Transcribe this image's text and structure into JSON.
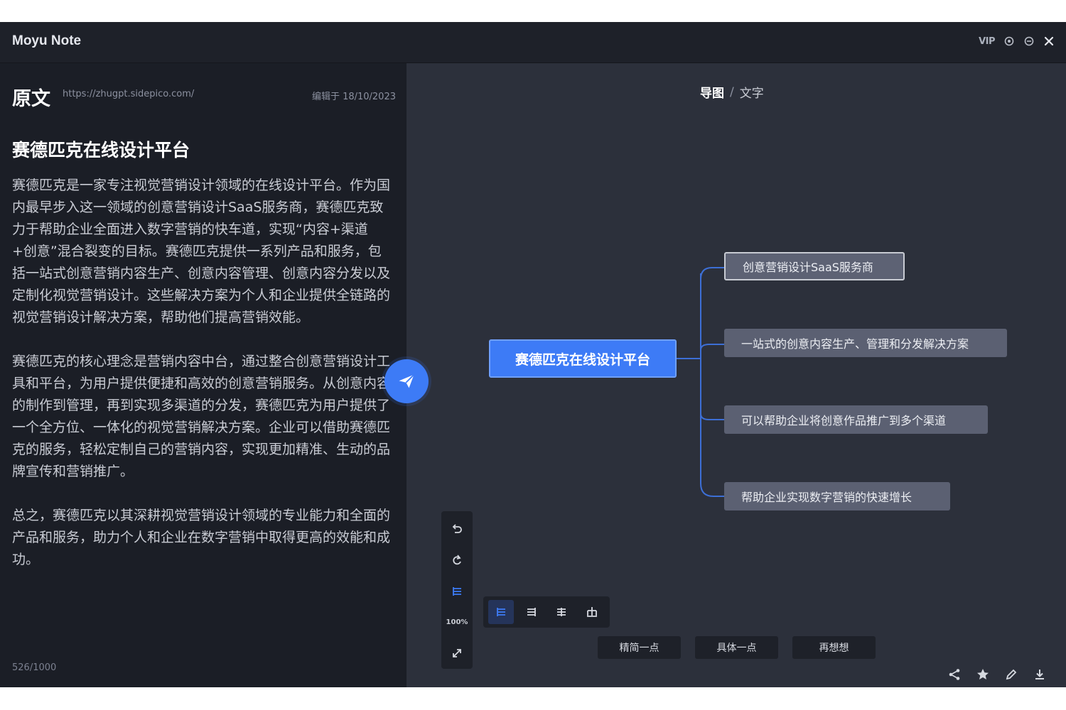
{
  "app": {
    "title": "Moyu Note",
    "vip_label": "VIP"
  },
  "left": {
    "heading": "原文",
    "url": "https://zhugpt.sidepico.com/",
    "edited": "编辑于 18/10/2023",
    "doc_title": "赛德匹克在线设计平台",
    "paragraphs": [
      "赛德匹克是一家专注视觉营销设计领域的在线设计平台。作为国内最早步入这一领域的创意营销设计SaaS服务商，赛德匹克致力于帮助企业全面进入数字营销的快车道，实现“内容+渠道+创意”混合裂变的目标。赛德匹克提供一系列产品和服务，包括一站式创意营销内容生产、创意内容管理、创意内容分发以及定制化视觉营销设计。这些解决方案为个人和企业提供全链路的视觉营销设计解决方案，帮助他们提高营销效能。",
      "赛德匹克的核心理念是营销内容中台，通过整合创意营销设计工具和平台，为用户提供便捷和高效的创意营销服务。从创意内容的制作到管理，再到实现多渠道的分发，赛德匹克为用户提供了一个全方位、一体化的视觉营销解决方案。企业可以借助赛德匹克的服务，轻松定制自己的营销内容，实现更加精准、生动的品牌宣传和营销推广。",
      "总之，赛德匹克以其深耕视觉营销设计领域的专业能力和全面的产品和服务，助力个人和企业在数字营销中取得更高的效能和成功。"
    ],
    "char_count": "526/1000"
  },
  "canvas": {
    "breadcrumb": {
      "active": "导图",
      "separator": "/",
      "other": "文字"
    },
    "mindmap": {
      "root": "赛德匹克在线设计平台",
      "children": [
        "创意营销设计SaaS服务商",
        "一站式的创意内容生产、管理和分发解决方案",
        "可以帮助企业将创意作品推广到多个渠道",
        "帮助企业实现数字营销的快速增长"
      ]
    },
    "zoom": "100%",
    "actions": [
      "精简一点",
      "具体一点",
      "再想想"
    ],
    "colors": {
      "accent": "#3d7bf6",
      "node": "#5b6072",
      "line": "#3d6fd6"
    }
  }
}
